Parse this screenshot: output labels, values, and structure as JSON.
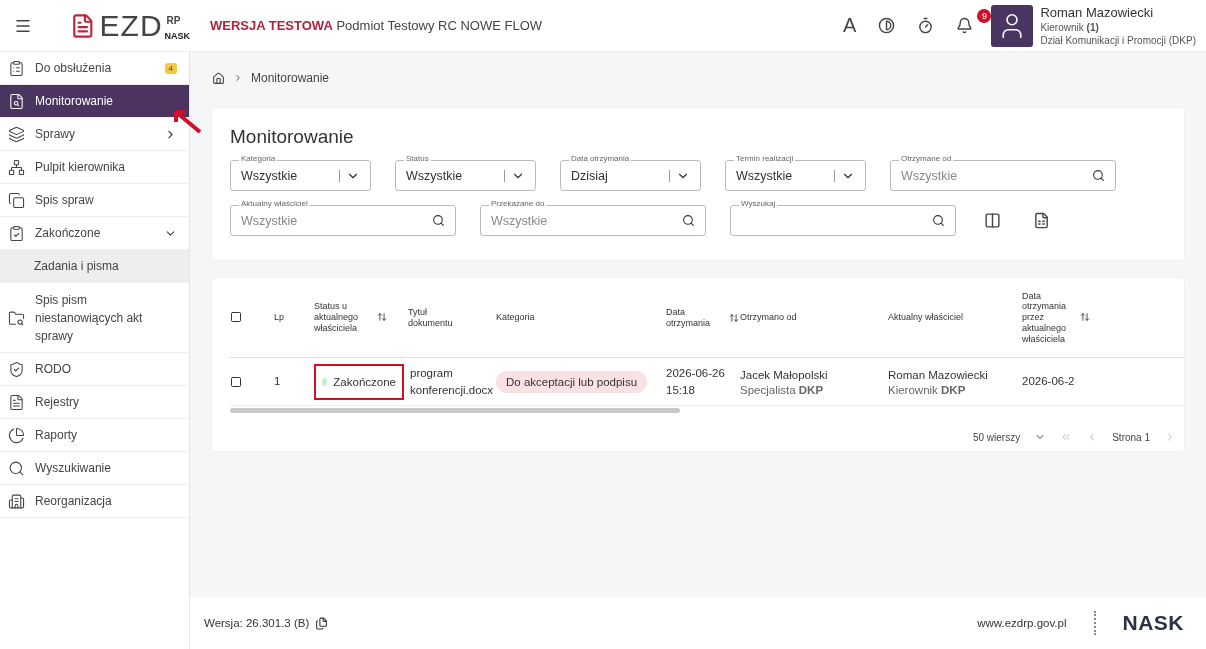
{
  "header": {
    "test_label": "WERSJA TESTOWA",
    "org": "Podmiot Testowy RC NOWE FLOW",
    "logo": {
      "text": "EZD",
      "sup": "RP",
      "sub": "NASK"
    },
    "font_toggle": "A",
    "notifications": "9",
    "user": {
      "name": "Roman Mazowiecki",
      "role": "Kierownik",
      "role_count": "(1)",
      "department": "Dział Komunikacji i Promocji (DKP)"
    }
  },
  "sidebar": {
    "items": [
      {
        "label": "Do obsłużenia",
        "badge": "4",
        "selected": false
      },
      {
        "label": "Monitorowanie",
        "selected": true
      },
      {
        "label": "Sprawy",
        "selected": false,
        "expanded": false
      },
      {
        "label": "Pulpit kierownika",
        "selected": false
      },
      {
        "label": "Spis spraw",
        "selected": false
      },
      {
        "label": "Zakończone",
        "selected": false,
        "expanded": true,
        "children": [
          {
            "label": "Zadania i pisma",
            "selected": true
          }
        ]
      },
      {
        "label": "Spis pism niestanowiących akt sprawy",
        "selected": false
      },
      {
        "label": "RODO",
        "selected": false
      },
      {
        "label": "Rejestry",
        "selected": false
      },
      {
        "label": "Raporty",
        "selected": false
      },
      {
        "label": "Wyszukiwanie",
        "selected": false
      },
      {
        "label": "Reorganizacja",
        "selected": false
      }
    ]
  },
  "breadcrumb": [
    "Monitorowanie"
  ],
  "filters": {
    "title": "Monitorowanie",
    "fields": [
      {
        "label": "Kategoria",
        "kind": "select",
        "value": "Wszystkie"
      },
      {
        "label": "Status",
        "kind": "select",
        "value": "Wszystkie"
      },
      {
        "label": "Data otrzymania",
        "kind": "select",
        "value": "Dzisiaj"
      },
      {
        "label": "Termin realizacji",
        "kind": "select",
        "value": "Wszystkie"
      },
      {
        "label": "Otrzymane od",
        "kind": "search",
        "placeholder": "Wszystkie"
      },
      {
        "label": "Aktualny właściciel",
        "kind": "search",
        "placeholder": "Wszystkie"
      },
      {
        "label": "Przekazane do",
        "kind": "search",
        "placeholder": "Wszystkie"
      },
      {
        "label": "Wyszukaj",
        "kind": "search"
      }
    ]
  },
  "table": {
    "all_checked": false,
    "columns": [
      {
        "label": "Lp",
        "sortable": false
      },
      {
        "label": "Status u aktualnego właściciela",
        "sortable": true
      },
      {
        "label": "Tytuł dokumentu",
        "sortable": false
      },
      {
        "label": "Kategoria",
        "sortable": false
      },
      {
        "label": "Data otrzymania",
        "sortable": true
      },
      {
        "label": "Otrzymano od",
        "sortable": false
      },
      {
        "label": "Aktualny właściciel",
        "sortable": false
      },
      {
        "label": "Data otrzymania przez aktualnego właściciela",
        "sortable": true
      }
    ],
    "rows": [
      {
        "checked": false,
        "lp": "1",
        "status": {
          "text": "Zakończone",
          "color": "#c8ecd0",
          "highlighted": true
        },
        "title": "program konferencji.docx",
        "category": "Do akceptacji lub podpisu",
        "date": "2026-06-26 15:18",
        "from": {
          "name": "Jacek Małopolski",
          "role": "Specjalista **DKP**"
        },
        "owner": {
          "name": "Roman Mazowiecki",
          "role": "Kierownik **DKP**"
        },
        "owner_date": "2026-06-2"
      }
    ],
    "pagination": {
      "rows_per_page": "50 wierszy",
      "page": "Strona 1"
    }
  },
  "footer": {
    "version": "Wersja: 26.301.3 (B)",
    "url": "www.ezdrp.gov.pl",
    "logo": "NASK"
  }
}
